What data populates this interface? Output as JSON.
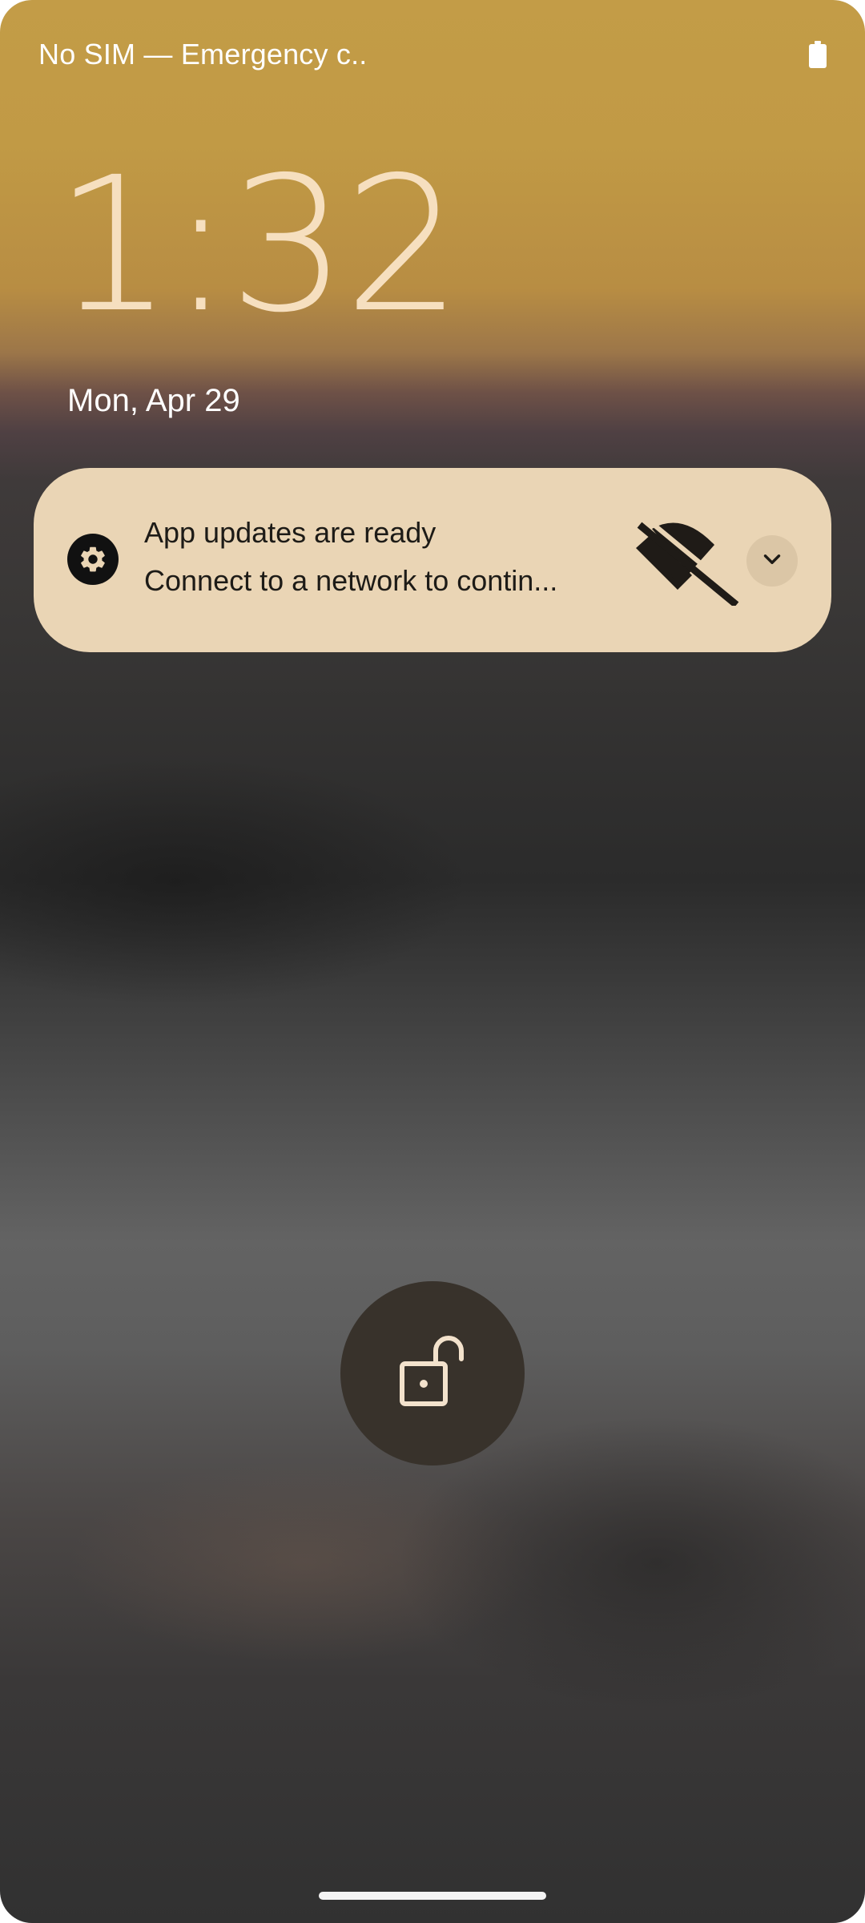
{
  "status_bar": {
    "carrier_text": "No SIM — Emergency c..",
    "battery_icon": "battery-icon"
  },
  "lockscreen": {
    "time": "1:32",
    "date": "Mon, Apr 29"
  },
  "notification": {
    "app_icon": "settings-gear-icon",
    "title": "App updates are ready",
    "text": "Connect to a network to contin...",
    "large_icon": "wifi-off-icon",
    "expand_icon": "chevron-down-icon"
  },
  "unlock": {
    "icon": "lock-open-icon"
  },
  "colors": {
    "clock": "#f6dfbf",
    "notification_bg": "#ead5b5",
    "unlock_bg": "#38322b"
  }
}
